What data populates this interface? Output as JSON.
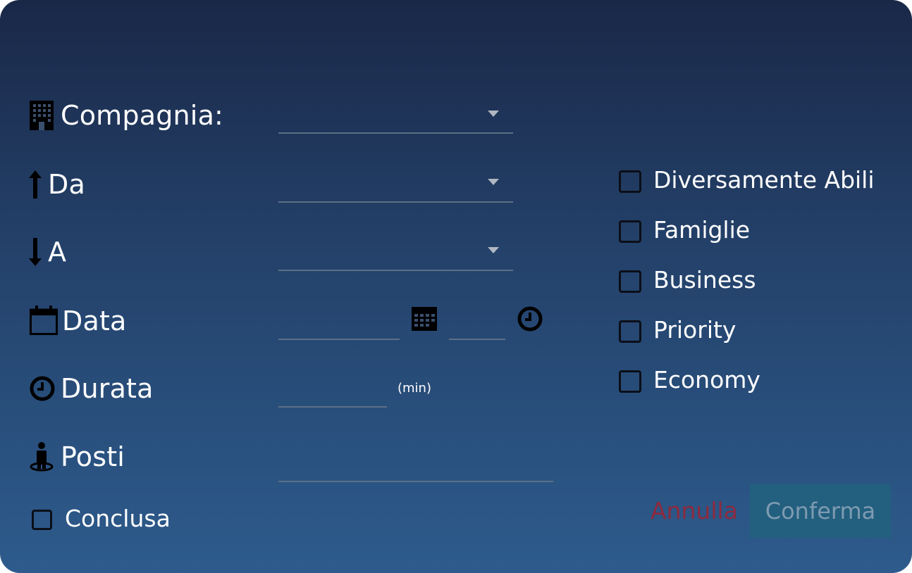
{
  "form": {
    "company_label": "Compagnia:",
    "from_label": "Da",
    "to_label": "A",
    "date_label": "Data",
    "duration_label": "Durata",
    "duration_unit": "(min)",
    "seats_label": "Posti",
    "completed_label": "Conclusa"
  },
  "options": [
    {
      "label": "Diversamente Abili"
    },
    {
      "label": "Famiglie"
    },
    {
      "label": "Business"
    },
    {
      "label": "Priority"
    },
    {
      "label": "Economy"
    }
  ],
  "actions": {
    "cancel_label": "Annulla",
    "confirm_label": "Conferma"
  },
  "icons": {
    "company": "building-icon",
    "from": "arrow-up-icon",
    "to": "arrow-down-icon",
    "date": "calendar-icon",
    "duration": "clock-icon",
    "seats": "person-icon"
  },
  "colors": {
    "cancel": "#8d2a3e",
    "confirm_bg": "#235f7f",
    "confirm_text": "#7d9bb1"
  }
}
